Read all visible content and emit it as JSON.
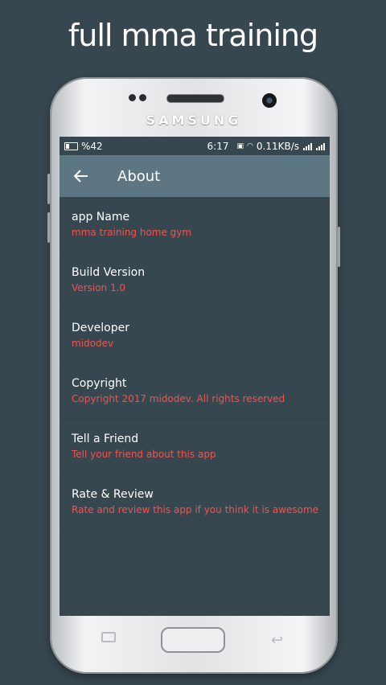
{
  "promo": {
    "title": "full mma training"
  },
  "device": {
    "brand": "SAMSUNG"
  },
  "statusbar": {
    "battery": "%42",
    "time": "6:17",
    "network": "0.11KB/s"
  },
  "appbar": {
    "title": "About",
    "back_icon": "arrow-back-icon"
  },
  "items": [
    {
      "title": "app Name",
      "subtitle": "mma training home gym"
    },
    {
      "title": "Build Version",
      "subtitle": "Version 1.0"
    },
    {
      "title": "Developer",
      "subtitle": "midodev"
    },
    {
      "title": "Copyright",
      "subtitle": "Copyright 2017 midodev. All rights reserved"
    },
    {
      "title": "Tell a Friend",
      "subtitle": "Tell your friend about this app"
    },
    {
      "title": "Rate & Review",
      "subtitle": "Rate and review this app if you think it is awesome"
    }
  ],
  "colors": {
    "background": "#37474f",
    "appbar": "#5d7684",
    "accent": "#ef5350"
  }
}
